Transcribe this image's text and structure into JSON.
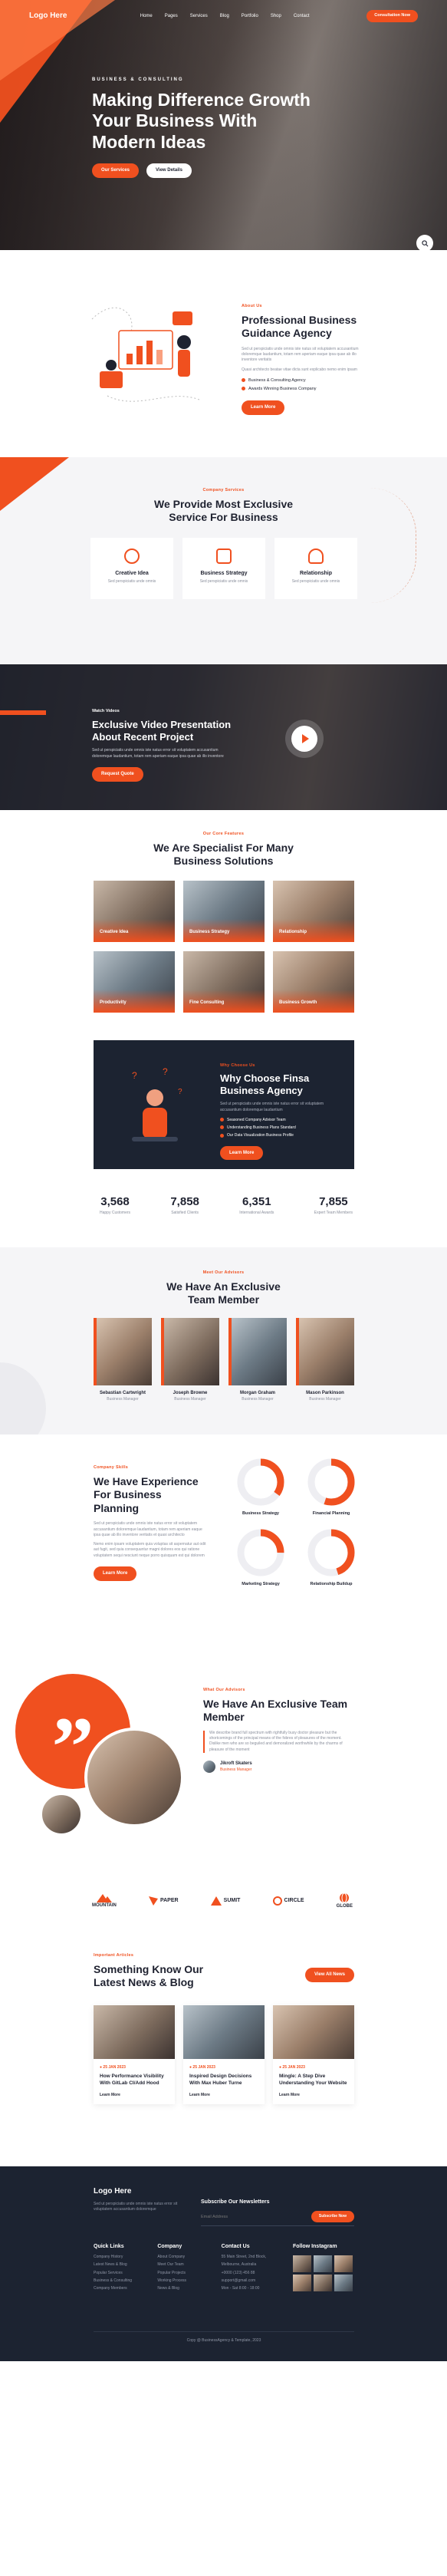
{
  "nav": {
    "logo": "Logo Here",
    "items": [
      "Home",
      "Pages",
      "Services",
      "Blog",
      "Portfolio",
      "Shop",
      "Contact"
    ],
    "cta": "Consultation Now"
  },
  "hero": {
    "eyebrow": "BUSINESS & CONSULTING",
    "title": "Making Difference Growth Your Business With Modern Ideas",
    "btn1": "Our Services",
    "btn2": "View Details"
  },
  "about": {
    "eyebrow": "About Us",
    "title": "Professional Business Guidance Agency",
    "text1": "Sed ut perspiciatis unde omnis iste natus sit voluptatem accusantium doloremque laudantium, totam rem aperiam eaque ipsa quae ab illo inventore veritatis",
    "text2": "Quasi architecto beatae vitae dicta sunt explicabo nemo enim ipsam",
    "list": [
      "Business & Consulting Agency",
      "Awards Winning Business Company"
    ],
    "btn": "Learn More"
  },
  "services": {
    "eyebrow": "Company Services",
    "title": "We Provide Most Exclusive Service For Business",
    "cards": [
      {
        "title": "Creative Idea",
        "text": "Sed perspiciatis unde omnis"
      },
      {
        "title": "Business Strategy",
        "text": "Sed perspiciatis unde omnis"
      },
      {
        "title": "Relationship",
        "text": "Sed perspiciatis unde omnis"
      }
    ]
  },
  "video": {
    "eyebrow": "Watch Videos",
    "title": "Exclusive Video Presentation About Recent Project",
    "text": "Sed ut perspiciatis unde omnis iste natus error sit voluptatem accusantium doloremque laudantium, totam rem aperiam eaque ipsa quae ab illo inventore",
    "btn": "Request Quote"
  },
  "specialist": {
    "eyebrow": "Our Core Features",
    "title": "We Are Specialist For Many Business Solutions",
    "items": [
      "Creative Idea",
      "Business Strategy",
      "Relationship",
      "Productivity",
      "Fine Consulting",
      "Business Growth"
    ]
  },
  "why": {
    "eyebrow": "Why Choose Us",
    "title": "Why Choose Finsa Business Agency",
    "text": "Sed ut perspiciatis unde omnis iste natus error sit voluptatem accusantium doloremque laudantium",
    "list": [
      "Seasoned Company Advisor Team",
      "Understanding Business Plans Standard",
      "Our Data Visualization Business Profile"
    ],
    "btn": "Learn More"
  },
  "stats": [
    {
      "value": "3,568",
      "label": "Happy Customers"
    },
    {
      "value": "7,858",
      "label": "Satisfied Clients"
    },
    {
      "value": "6,351",
      "label": "International Awards"
    },
    {
      "value": "7,855",
      "label": "Expert Team Members"
    }
  ],
  "team": {
    "eyebrow": "Meet Our Advisors",
    "title": "We Have An Exclusive Team Member",
    "members": [
      {
        "name": "Sebastian Cartwright",
        "role": "Business Manager"
      },
      {
        "name": "Joseph Browne",
        "role": "Business Manager"
      },
      {
        "name": "Morgan Graham",
        "role": "Business Manager"
      },
      {
        "name": "Mason Parkinson",
        "role": "Business Manager"
      }
    ]
  },
  "planning": {
    "eyebrow": "Company Skills",
    "title": "We Have Experience For Business Planning",
    "text1": "Sed ut perspiciatis unde omnis iste natus error sit voluptatem accusantium doloremque laudantium, totam rem aperiam eaque ipsa quae ab illo inventore veritatis et quasi architecto",
    "text2": "Nemo enim ipsam voluptatem quia voluptas sit aspernatur aut odit aut fugit, sed quia consequuntur magni dolores eos qui ratione voluptatem sequi nesciunt neque porro quisquam est qui dolorem",
    "btn": "Learn More",
    "charts": [
      {
        "label": "Business Strategy",
        "pct": 0.35
      },
      {
        "label": "Financial Planning",
        "pct": 0.55
      },
      {
        "label": "Marketing Strategy",
        "pct": 0.25
      },
      {
        "label": "Relationship Buildup",
        "pct": 0.45
      }
    ]
  },
  "testimonial": {
    "eyebrow": "What Our Advisors",
    "title": "We Have An Exclusive Team Member",
    "text": "We describe brand full spectrum with rightfully busy doctor pleasure but the shortcomings of the principal means of the fobres of pleasures of the moment. Dislike men who are so beguiled and demoralized worthwhile by the charms of pleasure of the moment",
    "name": "Jikroft Skaters",
    "role": "Business Manager"
  },
  "brands": [
    "MOUNTAIN",
    "PAPER",
    "SUMIT",
    "CIRCLE",
    "GLOBE"
  ],
  "news": {
    "eyebrow": "Important Articles",
    "title": "Something Know Our Latest News & Blog",
    "btn": "View All News",
    "posts": [
      {
        "date": "25 JAN 2023",
        "title": "How Performance Visibility With GitLab CI/Add Hood",
        "more": "Learn More"
      },
      {
        "date": "25 JAN 2023",
        "title": "Inspired Design Decisions With Max Huber Turne",
        "more": "Learn More"
      },
      {
        "date": "25 JAN 2023",
        "title": "Mingle: A Step Dive Understanding Your Website",
        "more": "Learn More"
      }
    ]
  },
  "footer": {
    "logo": "Logo Here",
    "about": "Sed ut perspiciatis unde omnis iste natus error sit voluptatem accusantium doloremque",
    "newsletter": "Subscribe Our Newsletters",
    "email_ph": "Email Address",
    "subscribe": "Subscribe Now",
    "cols": [
      {
        "title": "Quick Links",
        "items": [
          "Company History",
          "Latest News & Blog",
          "Popular Services",
          "Business & Consulting",
          "Company Members"
        ]
      },
      {
        "title": "Company",
        "items": [
          "About Company",
          "Meet Our Team",
          "Popular Projects",
          "Working Process",
          "News & Blog"
        ]
      },
      {
        "title": "Contact Us",
        "items": [
          "55 Main Street, 2nd Block,",
          "Melbourne, Australia",
          "+0000 (123) 456 88",
          "support@gmail.com",
          "Mon - Sat 8:00 - 18:00"
        ]
      },
      {
        "title": "Follow Instagram",
        "items": []
      }
    ],
    "copyright": "Copy @ BusinessAgency & Template, 2023"
  },
  "colors": {
    "accent": "#f0501f",
    "dark": "#1c2331"
  }
}
